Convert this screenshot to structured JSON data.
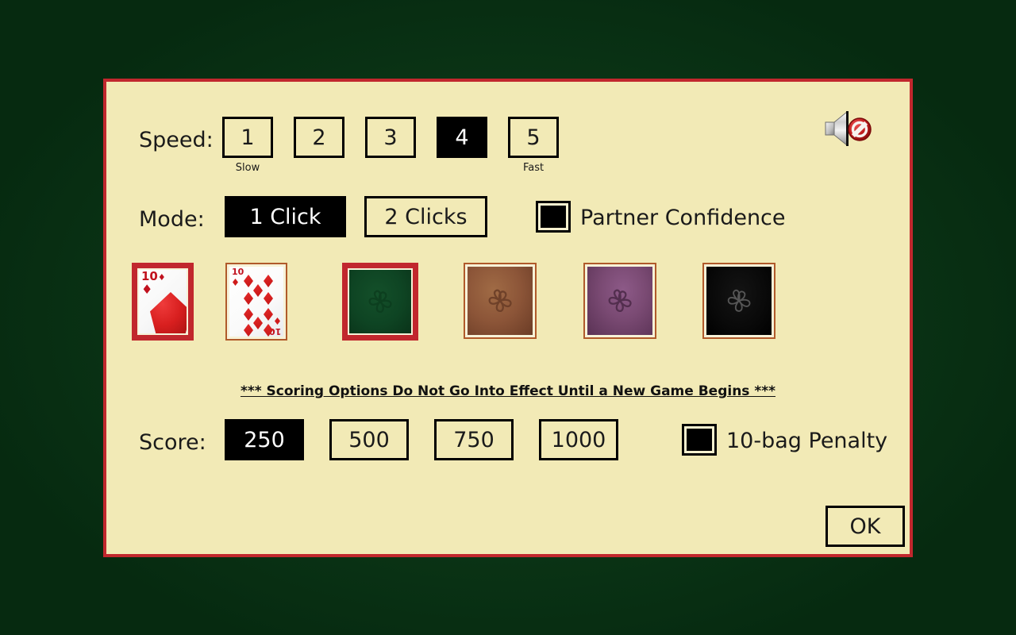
{
  "background": {
    "color": "#0a3315"
  },
  "dialog": {
    "background": "#f2eab6",
    "border_color": "#c1272d"
  },
  "speed": {
    "label": "Speed:",
    "options": [
      {
        "value": "1",
        "selected": false
      },
      {
        "value": "2",
        "selected": false
      },
      {
        "value": "3",
        "selected": false
      },
      {
        "value": "4",
        "selected": true
      },
      {
        "value": "5",
        "selected": false
      }
    ],
    "hint_slow": "Slow",
    "hint_fast": "Fast"
  },
  "sound": {
    "icon": "speaker-muted-icon",
    "muted": true,
    "prohibit_color": "#c1272d"
  },
  "mode": {
    "label": "Mode:",
    "options": [
      {
        "value": "1 Click",
        "selected": true
      },
      {
        "value": "2 Clicks",
        "selected": false
      }
    ],
    "partner_confidence": {
      "label": "Partner Confidence",
      "checked": false
    }
  },
  "card_styles": {
    "items": [
      {
        "id": "big-pip-face",
        "kind": "face-big",
        "rank": "10",
        "suit": "♦",
        "selected": true,
        "label": "Large pip card face"
      },
      {
        "id": "standard-face",
        "kind": "face-std",
        "rank": "10",
        "suit": "♦",
        "selected": false,
        "label": "Standard card face"
      },
      {
        "id": "green-back",
        "kind": "back",
        "color": "#0e4423",
        "flower": "#0b3a1d",
        "selected": true,
        "label": "Green flower card back"
      },
      {
        "id": "brown-back",
        "kind": "back",
        "color": "#8c5538",
        "flower": "#6d3f28",
        "selected": false,
        "label": "Brown flower card back"
      },
      {
        "id": "purple-back",
        "kind": "back",
        "color": "#7a4a73",
        "flower": "#56304f",
        "selected": false,
        "label": "Purple flower card back"
      },
      {
        "id": "black-back",
        "kind": "back",
        "color": "#090909",
        "flower": "#4a4a4a",
        "selected": false,
        "label": "Black flower card back"
      }
    ]
  },
  "scoring": {
    "note": "*** Scoring Options Do Not Go Into Effect Until a New Game Begins ***",
    "label": "Score:",
    "options": [
      {
        "value": "250",
        "selected": true
      },
      {
        "value": "500",
        "selected": false
      },
      {
        "value": "750",
        "selected": false
      },
      {
        "value": "1000",
        "selected": false
      }
    ],
    "penalty": {
      "label": "10-bag Penalty",
      "checked": false
    }
  },
  "footer": {
    "ok_label": "OK"
  }
}
